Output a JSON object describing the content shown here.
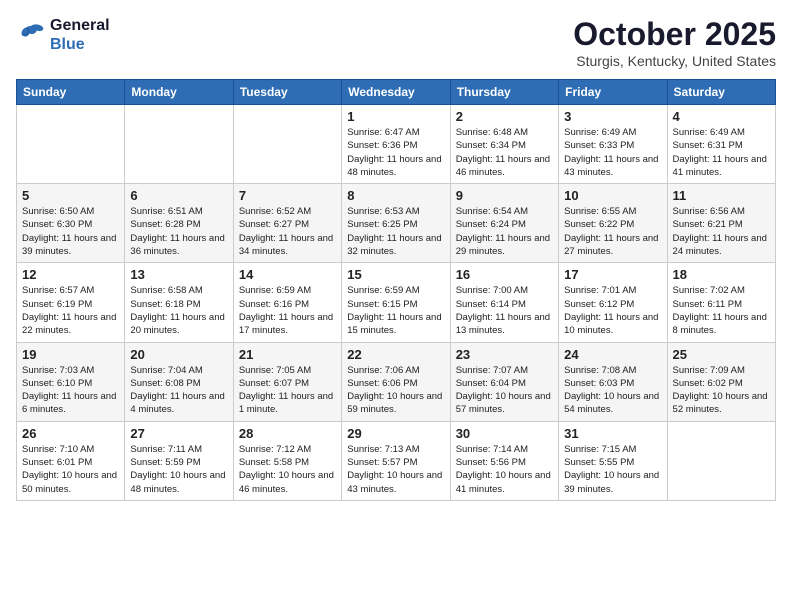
{
  "header": {
    "logo_line1": "General",
    "logo_line2": "Blue",
    "month": "October 2025",
    "location": "Sturgis, Kentucky, United States"
  },
  "days_of_week": [
    "Sunday",
    "Monday",
    "Tuesday",
    "Wednesday",
    "Thursday",
    "Friday",
    "Saturday"
  ],
  "weeks": [
    [
      {
        "day": "",
        "info": ""
      },
      {
        "day": "",
        "info": ""
      },
      {
        "day": "",
        "info": ""
      },
      {
        "day": "1",
        "info": "Sunrise: 6:47 AM\nSunset: 6:36 PM\nDaylight: 11 hours and 48 minutes."
      },
      {
        "day": "2",
        "info": "Sunrise: 6:48 AM\nSunset: 6:34 PM\nDaylight: 11 hours and 46 minutes."
      },
      {
        "day": "3",
        "info": "Sunrise: 6:49 AM\nSunset: 6:33 PM\nDaylight: 11 hours and 43 minutes."
      },
      {
        "day": "4",
        "info": "Sunrise: 6:49 AM\nSunset: 6:31 PM\nDaylight: 11 hours and 41 minutes."
      }
    ],
    [
      {
        "day": "5",
        "info": "Sunrise: 6:50 AM\nSunset: 6:30 PM\nDaylight: 11 hours and 39 minutes."
      },
      {
        "day": "6",
        "info": "Sunrise: 6:51 AM\nSunset: 6:28 PM\nDaylight: 11 hours and 36 minutes."
      },
      {
        "day": "7",
        "info": "Sunrise: 6:52 AM\nSunset: 6:27 PM\nDaylight: 11 hours and 34 minutes."
      },
      {
        "day": "8",
        "info": "Sunrise: 6:53 AM\nSunset: 6:25 PM\nDaylight: 11 hours and 32 minutes."
      },
      {
        "day": "9",
        "info": "Sunrise: 6:54 AM\nSunset: 6:24 PM\nDaylight: 11 hours and 29 minutes."
      },
      {
        "day": "10",
        "info": "Sunrise: 6:55 AM\nSunset: 6:22 PM\nDaylight: 11 hours and 27 minutes."
      },
      {
        "day": "11",
        "info": "Sunrise: 6:56 AM\nSunset: 6:21 PM\nDaylight: 11 hours and 24 minutes."
      }
    ],
    [
      {
        "day": "12",
        "info": "Sunrise: 6:57 AM\nSunset: 6:19 PM\nDaylight: 11 hours and 22 minutes."
      },
      {
        "day": "13",
        "info": "Sunrise: 6:58 AM\nSunset: 6:18 PM\nDaylight: 11 hours and 20 minutes."
      },
      {
        "day": "14",
        "info": "Sunrise: 6:59 AM\nSunset: 6:16 PM\nDaylight: 11 hours and 17 minutes."
      },
      {
        "day": "15",
        "info": "Sunrise: 6:59 AM\nSunset: 6:15 PM\nDaylight: 11 hours and 15 minutes."
      },
      {
        "day": "16",
        "info": "Sunrise: 7:00 AM\nSunset: 6:14 PM\nDaylight: 11 hours and 13 minutes."
      },
      {
        "day": "17",
        "info": "Sunrise: 7:01 AM\nSunset: 6:12 PM\nDaylight: 11 hours and 10 minutes."
      },
      {
        "day": "18",
        "info": "Sunrise: 7:02 AM\nSunset: 6:11 PM\nDaylight: 11 hours and 8 minutes."
      }
    ],
    [
      {
        "day": "19",
        "info": "Sunrise: 7:03 AM\nSunset: 6:10 PM\nDaylight: 11 hours and 6 minutes."
      },
      {
        "day": "20",
        "info": "Sunrise: 7:04 AM\nSunset: 6:08 PM\nDaylight: 11 hours and 4 minutes."
      },
      {
        "day": "21",
        "info": "Sunrise: 7:05 AM\nSunset: 6:07 PM\nDaylight: 11 hours and 1 minute."
      },
      {
        "day": "22",
        "info": "Sunrise: 7:06 AM\nSunset: 6:06 PM\nDaylight: 10 hours and 59 minutes."
      },
      {
        "day": "23",
        "info": "Sunrise: 7:07 AM\nSunset: 6:04 PM\nDaylight: 10 hours and 57 minutes."
      },
      {
        "day": "24",
        "info": "Sunrise: 7:08 AM\nSunset: 6:03 PM\nDaylight: 10 hours and 54 minutes."
      },
      {
        "day": "25",
        "info": "Sunrise: 7:09 AM\nSunset: 6:02 PM\nDaylight: 10 hours and 52 minutes."
      }
    ],
    [
      {
        "day": "26",
        "info": "Sunrise: 7:10 AM\nSunset: 6:01 PM\nDaylight: 10 hours and 50 minutes."
      },
      {
        "day": "27",
        "info": "Sunrise: 7:11 AM\nSunset: 5:59 PM\nDaylight: 10 hours and 48 minutes."
      },
      {
        "day": "28",
        "info": "Sunrise: 7:12 AM\nSunset: 5:58 PM\nDaylight: 10 hours and 46 minutes."
      },
      {
        "day": "29",
        "info": "Sunrise: 7:13 AM\nSunset: 5:57 PM\nDaylight: 10 hours and 43 minutes."
      },
      {
        "day": "30",
        "info": "Sunrise: 7:14 AM\nSunset: 5:56 PM\nDaylight: 10 hours and 41 minutes."
      },
      {
        "day": "31",
        "info": "Sunrise: 7:15 AM\nSunset: 5:55 PM\nDaylight: 10 hours and 39 minutes."
      },
      {
        "day": "",
        "info": ""
      }
    ]
  ]
}
